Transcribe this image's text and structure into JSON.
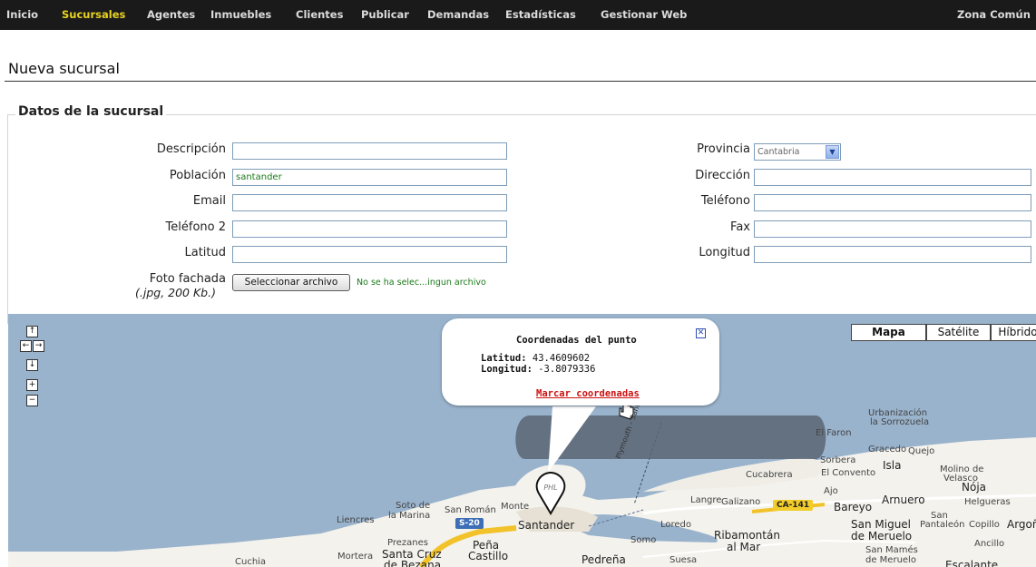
{
  "nav": {
    "items": [
      {
        "label": "Inicio",
        "active": false
      },
      {
        "label": "Sucursales",
        "active": true
      },
      {
        "label": "Agentes",
        "active": false
      },
      {
        "label": "Inmuebles",
        "active": false
      },
      {
        "label": "Clientes",
        "active": false
      },
      {
        "label": "Publicar",
        "active": false
      },
      {
        "label": "Demandas",
        "active": false
      },
      {
        "label": "Estadísticas",
        "active": false
      },
      {
        "label": "Gestionar Web",
        "active": false
      }
    ],
    "right_label": "Zona Común"
  },
  "page": {
    "title": "Nueva sucursal",
    "section_title": "Datos de la sucursal"
  },
  "form": {
    "descripcion": {
      "label": "Descripción",
      "value": ""
    },
    "poblacion": {
      "label": "Población",
      "value": "santander"
    },
    "email": {
      "label": "Email",
      "value": ""
    },
    "telefono2": {
      "label": "Teléfono 2",
      "value": ""
    },
    "latitud": {
      "label": "Latitud",
      "value": ""
    },
    "foto": {
      "label": "Foto fachada",
      "note": "(.jpg, 200 Kb.)",
      "button_label": "Seleccionar archivo",
      "status": "No se ha selec...ingun archivo"
    },
    "provincia": {
      "label": "Provincia",
      "value": "Cantabria"
    },
    "direccion": {
      "label": "Dirección",
      "value": ""
    },
    "telefono": {
      "label": "Teléfono",
      "value": ""
    },
    "fax": {
      "label": "Fax",
      "value": ""
    },
    "longitud": {
      "label": "Longitud",
      "value": ""
    }
  },
  "map": {
    "nav_controls": {
      "up": "↑",
      "left": "←",
      "right": "→",
      "down": "↓",
      "zoom_in": "+",
      "zoom_out": "−"
    },
    "type_buttons": [
      {
        "label": "Mapa",
        "active": true
      },
      {
        "label": "Satélite",
        "active": false
      },
      {
        "label": "Híbrido",
        "active": false
      }
    ],
    "info_window": {
      "title": "Coordenadas del punto",
      "lat_label": "Latitud:",
      "lat_value": "43.4609602",
      "lon_label": "Longitud:",
      "lon_value": "-3.8079336",
      "link": "Marcar coordenadas",
      "close_icon": "close-icon"
    },
    "marker_label": "PHL",
    "places": [
      "Urbanización",
      "la Sorrozuela",
      "El Faron",
      "Gracedo",
      "Quejo",
      "Sorbera",
      "Isla",
      "Molino de",
      "Velasco",
      "El Convento",
      "Nója",
      "Cucabrera",
      "Ajo",
      "Arnuero",
      "Helgueras",
      "Langre",
      "Galizano",
      "Bareyo",
      "San",
      "Pantaleón",
      "Copillo",
      "Argoños",
      "San Miguel",
      "de Meruelo",
      "Ancillo",
      "San Mamés",
      "de Meruelo",
      "Escalante",
      "Ribamontán",
      "al Mar",
      "Loredo",
      "Somo",
      "Suesa",
      "Pedreña",
      "Santander",
      "Monte",
      "San Román",
      "Soto de",
      "la Marina",
      "Liencres",
      "Prezanes",
      "Peña",
      "Castillo",
      "Mortera",
      "Santa Cruz",
      "de Bezana",
      "Cuchia",
      "Plymouth - Santander"
    ],
    "roads": [
      "S-20",
      "CA-141"
    ]
  }
}
